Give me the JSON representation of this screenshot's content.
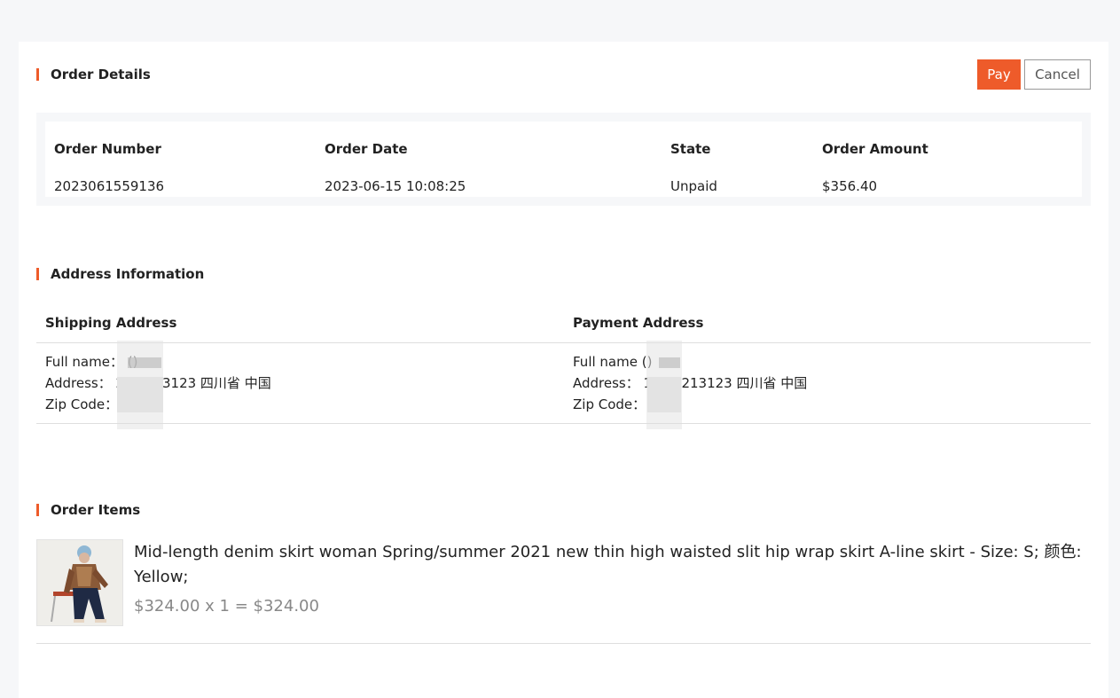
{
  "order_details": {
    "title": "Order Details",
    "pay_label": "Pay",
    "cancel_label": "Cancel",
    "headers": [
      "Order Number",
      "Order Date",
      "State",
      "Order Amount"
    ],
    "values": [
      "2023061559136",
      "2023-06-15 10:08:25",
      "Unpaid",
      "$356.40"
    ]
  },
  "address": {
    "title": "Address Information",
    "shipping": {
      "heading": "Shipping Address",
      "full_name": "Full name：        ()",
      "address": "Address：          23 3213123 四川省 中国",
      "zip": "Zip Code："
    },
    "payment": {
      "heading": "Payment Address",
      "full_name": "Full name         ()",
      "address": "Address：          123 3213123 四川省 中国",
      "zip": "Zip Code：          3"
    }
  },
  "order_items": {
    "title": "Order Items",
    "items": [
      {
        "name": "Mid-length denim skirt woman Spring/summer 2021 new thin high waisted slit hip wrap skirt A-line skirt - Size: S; 颜色: Yellow;",
        "price_line": "$324.00 x 1 = $324.00"
      }
    ]
  },
  "colors": {
    "accent": "#ee5b2a",
    "background": "#f6f7f9"
  }
}
